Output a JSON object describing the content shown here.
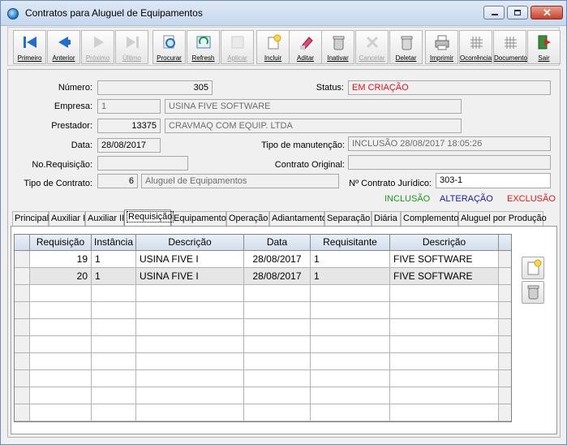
{
  "window": {
    "title": "Contratos para Aluguel de Equipamentos"
  },
  "toolbar": [
    {
      "label": "Primeiro",
      "icon": "first-record-icon",
      "enabled": true
    },
    {
      "label": "Anterior",
      "icon": "previous-record-icon",
      "enabled": true
    },
    {
      "label": "Próximo",
      "icon": "next-record-icon",
      "enabled": false
    },
    {
      "label": "Último",
      "icon": "last-record-icon",
      "enabled": false
    },
    {
      "label": "Procurar",
      "icon": "search-icon",
      "enabled": true
    },
    {
      "label": "Refresh",
      "icon": "refresh-icon",
      "enabled": true
    },
    {
      "label": "Aplicar",
      "icon": "apply-icon",
      "enabled": false
    },
    {
      "label": "Incluir",
      "icon": "new-document-icon",
      "enabled": true
    },
    {
      "label": "Aditar",
      "icon": "edit-icon",
      "enabled": true
    },
    {
      "label": "Inativar",
      "icon": "trash-icon",
      "enabled": true
    },
    {
      "label": "Cancelar",
      "icon": "cancel-icon",
      "enabled": false
    },
    {
      "label": "Deletar",
      "icon": "delete-icon",
      "enabled": true
    },
    {
      "label": "Imprimir",
      "icon": "printer-icon",
      "enabled": true
    },
    {
      "label": "Ocorrência",
      "icon": "grid-icon",
      "enabled": true
    },
    {
      "label": "Documento",
      "icon": "grid-icon",
      "enabled": true
    },
    {
      "label": "Sair",
      "icon": "exit-icon",
      "enabled": true
    }
  ],
  "form": {
    "numero_label": "Número:",
    "numero": "305",
    "status_label": "Status:",
    "status": "EM CRIAÇÃO",
    "empresa_label": "Empresa:",
    "empresa_code": "1",
    "empresa_name": "USINA FIVE SOFTWARE",
    "prestador_label": "Prestador:",
    "prestador_code": "13375",
    "prestador_name": "CRAVMAQ COM EQUIP. LTDA",
    "data_label": "Data:",
    "data": "28/08/2017",
    "manutencao_label": "Tipo de manutenção:",
    "manutencao": "INCLUSÃO 28/08/2017 18:05:26",
    "requisicao_label": "No.Requisição:",
    "requisicao": "",
    "contrato_original_label": "Contrato Original:",
    "contrato_original": "",
    "tipo_contrato_label": "Tipo de Contrato:",
    "tipo_contrato_code": "6",
    "tipo_contrato_name": "Aluguel de Equipamentos",
    "contrato_juridico_label": "Nº Contrato Jurídico:",
    "contrato_juridico": "303-1"
  },
  "legend": {
    "inclusao": "INCLUSÃO",
    "alteracao": "ALTERAÇÃO",
    "exclusao": "EXCLUSÃO"
  },
  "tabs": [
    "Principal",
    "Auxiliar I",
    "Auxiliar II",
    "Requisição",
    "Equipamento",
    "Operação",
    "Adiantamento",
    "Separação",
    "Diária",
    "Complemento",
    "Aluguel por Produção"
  ],
  "active_tab": "Requisição",
  "grid": {
    "columns": [
      "Requisição",
      "Instância",
      "Descrição",
      "Data",
      "Requisitante",
      "Descrição"
    ],
    "rows": [
      [
        "19",
        "1",
        "USINA FIVE I",
        "28/08/2017",
        "1",
        "FIVE SOFTWARE"
      ],
      [
        "20",
        "1",
        "USINA FIVE I",
        "28/08/2017",
        "1",
        "FIVE SOFTWARE"
      ]
    ]
  },
  "side_buttons": [
    {
      "name": "add-requisition-button",
      "icon": "new-document-icon"
    },
    {
      "name": "delete-requisition-button",
      "icon": "trash-icon"
    }
  ]
}
